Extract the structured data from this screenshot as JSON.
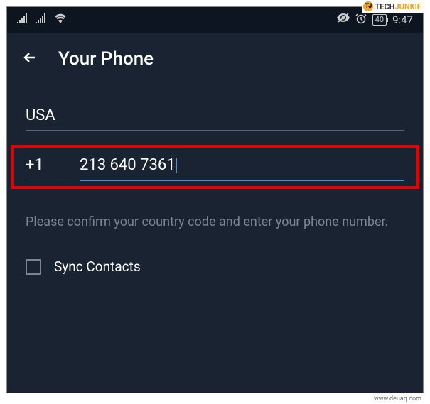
{
  "watermark": {
    "tj_icon": "TJ",
    "tj_tech": "TECH",
    "tj_junkie": "JUNKIE",
    "bottom": "www.deuaq.com"
  },
  "status_bar": {
    "battery": "40",
    "time": "9:47"
  },
  "header": {
    "title": "Your Phone"
  },
  "form": {
    "country": "USA",
    "country_code": "+1",
    "phone_number": "213 640 7361",
    "helper": "Please confirm your country code and enter your phone number.",
    "sync_label": "Sync Contacts"
  }
}
